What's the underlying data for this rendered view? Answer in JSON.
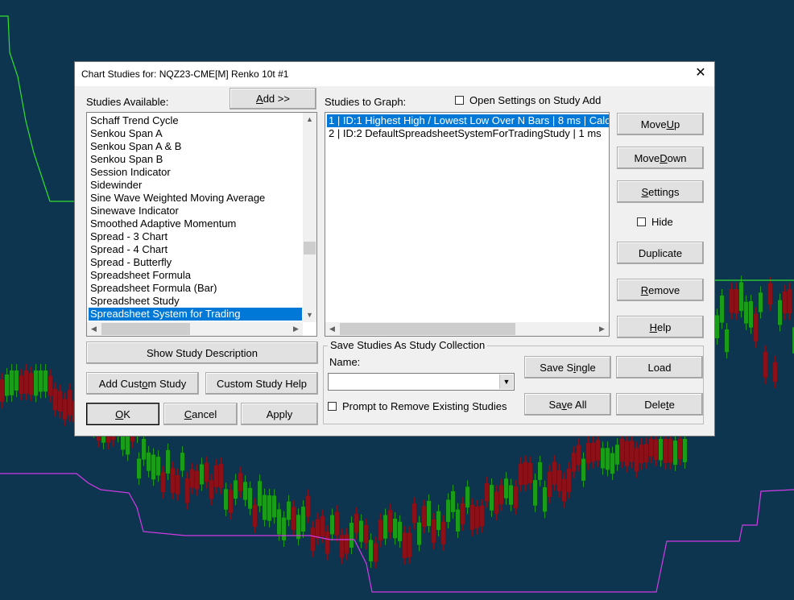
{
  "dialog": {
    "title": "Chart Studies for: NQZ23-CME[M]  Renko 10t #1",
    "close_symbol": "✕"
  },
  "available": {
    "label": "Studies Available:",
    "add_button": {
      "pre": "",
      "ul": "A",
      "post": "dd >>"
    },
    "items": [
      "Schaff Trend Cycle",
      "Senkou Span A",
      "Senkou Span A & B",
      "Senkou Span B",
      "Session Indicator",
      "Sidewinder",
      "Sine Wave Weighted Moving Average",
      "Sinewave Indicator",
      "Smoothed Adaptive Momentum",
      "Spread - 3 Chart",
      "Spread - 4 Chart",
      "Spread - Butterfly",
      "Spreadsheet Formula",
      "Spreadsheet Formula (Bar)",
      "Spreadsheet Study",
      "Spreadsheet System for Trading"
    ],
    "selected_index": 15
  },
  "graph": {
    "label": "Studies to Graph:",
    "open_settings_label": "Open Settings on Study Add",
    "items": [
      "1 | ID:1  Highest High / Lowest Low Over N Bars | 8 ms | Calc",
      "2 | ID:2  DefaultSpreadsheetSystemForTradingStudy | 1 ms"
    ],
    "selected_index": 0
  },
  "side_buttons": {
    "move_up": {
      "pre": "Move ",
      "ul": "U",
      "post": "p"
    },
    "move_down": {
      "pre": "Move ",
      "ul": "D",
      "post": "own"
    },
    "settings": {
      "pre": "",
      "ul": "S",
      "post": "ettings"
    },
    "hide_label": "Hide",
    "duplicate": {
      "pre": "Duplicate",
      "ul": "",
      "post": ""
    },
    "remove": {
      "pre": "",
      "ul": "R",
      "post": "emove"
    },
    "help": {
      "pre": "",
      "ul": "H",
      "post": "elp"
    }
  },
  "bottom_left": {
    "show_desc": "Show Study Description",
    "add_custom": {
      "pre": "Add Cust",
      "ul": "o",
      "post": "m Study"
    },
    "custom_help": "Custom Study Help",
    "ok": {
      "pre": "",
      "ul": "O",
      "post": "K"
    },
    "cancel": {
      "pre": "",
      "ul": "C",
      "post": "ancel"
    },
    "apply": {
      "pre": "Apply",
      "ul": "",
      "post": ""
    }
  },
  "collection": {
    "group_title": "Save Studies As Study Collection",
    "name_label": "Name:",
    "name_value": "",
    "prompt_label": "Prompt to Remove Existing Studies",
    "save_single": {
      "pre": "Save S",
      "ul": "i",
      "post": "ngle"
    },
    "load": "Load",
    "save_all": {
      "pre": "Sa",
      "ul": "v",
      "post": "e All"
    },
    "delete": {
      "pre": "Dele",
      "ul": "t",
      "post": "e"
    }
  },
  "colors": {
    "background": "#0e3550",
    "candle_up": "#1a9e1a",
    "candle_down": "#8c1018",
    "green_line": "#2de02d",
    "magenta_line": "#d23be6",
    "selection": "#0078d7"
  }
}
